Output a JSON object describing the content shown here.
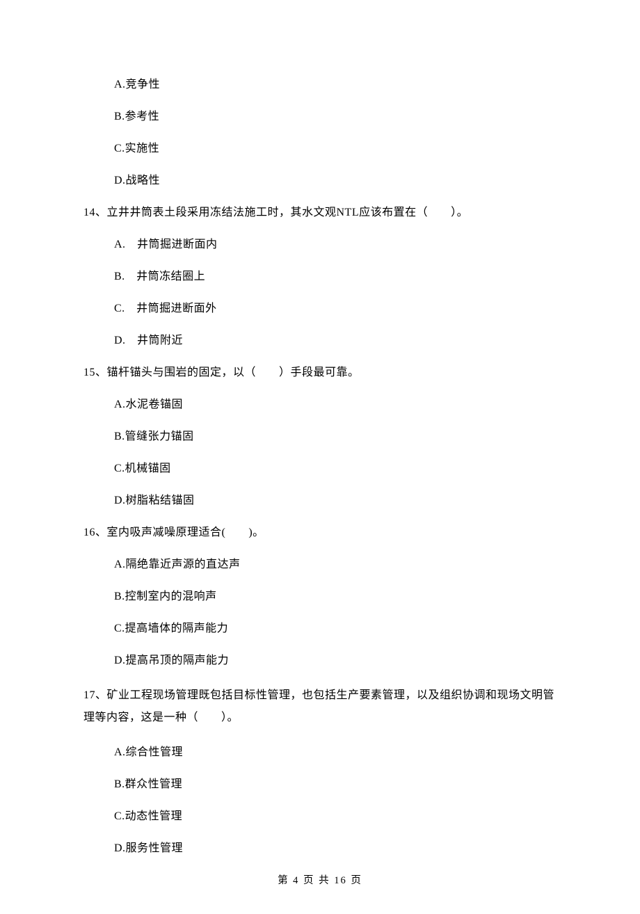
{
  "top_options": {
    "A": "A.竞争性",
    "B": "B.参考性",
    "C": "C.实施性",
    "D": "D.战略性"
  },
  "q14": {
    "stem": "14、立井井筒表土段采用冻结法施工时，其水文观NTL应该布置在（　　）。",
    "A": "A.　井筒掘进断面内",
    "B": "B.　井筒冻结圈上",
    "C": "C.　井筒掘进断面外",
    "D": "D.　井筒附近"
  },
  "q15": {
    "stem": "15、锚杆锚头与围岩的固定，以（　　）手段最可靠。",
    "A": "A.水泥卷锚固",
    "B": "B.管缝张力锚固",
    "C": "C.机械锚固",
    "D": "D.树脂粘结锚固"
  },
  "q16": {
    "stem": "16、室内吸声减噪原理适合(　　)。",
    "A": "A.隔绝靠近声源的直达声",
    "B": "B.控制室内的混响声",
    "C": "C.提高墙体的隔声能力",
    "D": "D.提高吊顶的隔声能力"
  },
  "q17": {
    "stem": "17、矿业工程现场管理既包括目标性管理，也包括生产要素管理，以及组织协调和现场文明管理等内容，这是一种（　　）。",
    "A": "A.综合性管理",
    "B": "B.群众性管理",
    "C": "C.动态性管理",
    "D": "D.服务性管理"
  },
  "footer": "第 4 页 共 16 页"
}
